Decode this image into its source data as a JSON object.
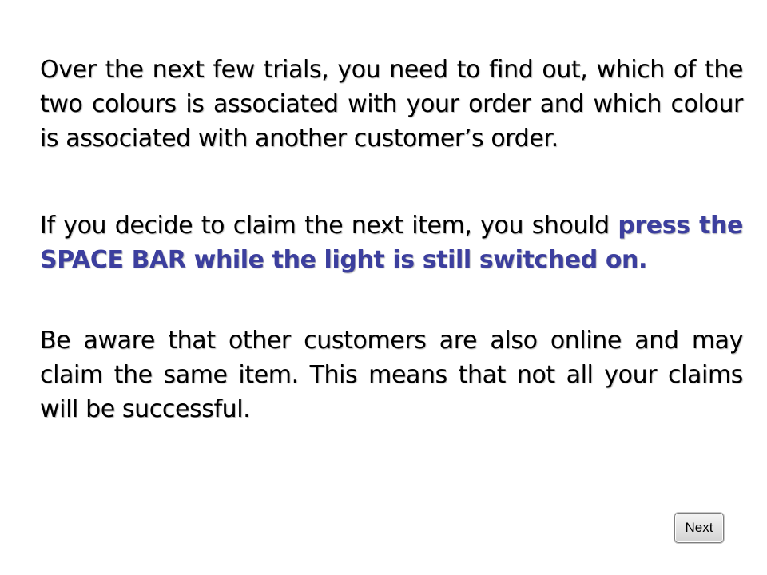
{
  "instructions": {
    "para1": "Over the next few trials, you need to find out, which of the two colours is associated with your order and which colour is associated with another customer’s order.",
    "para2_normal": "If you decide to claim the next item, you should ",
    "para2_emphasis": "press the SPACE BAR while the light is still switched on.",
    "para3": "Be aware that other customers are also online and may claim the same item. This means that not all your claims will be successful."
  },
  "navigation": {
    "next_label": "Next"
  },
  "colors": {
    "emphasis": "#3c3f9e",
    "text": "#000000",
    "background": "#ffffff"
  }
}
